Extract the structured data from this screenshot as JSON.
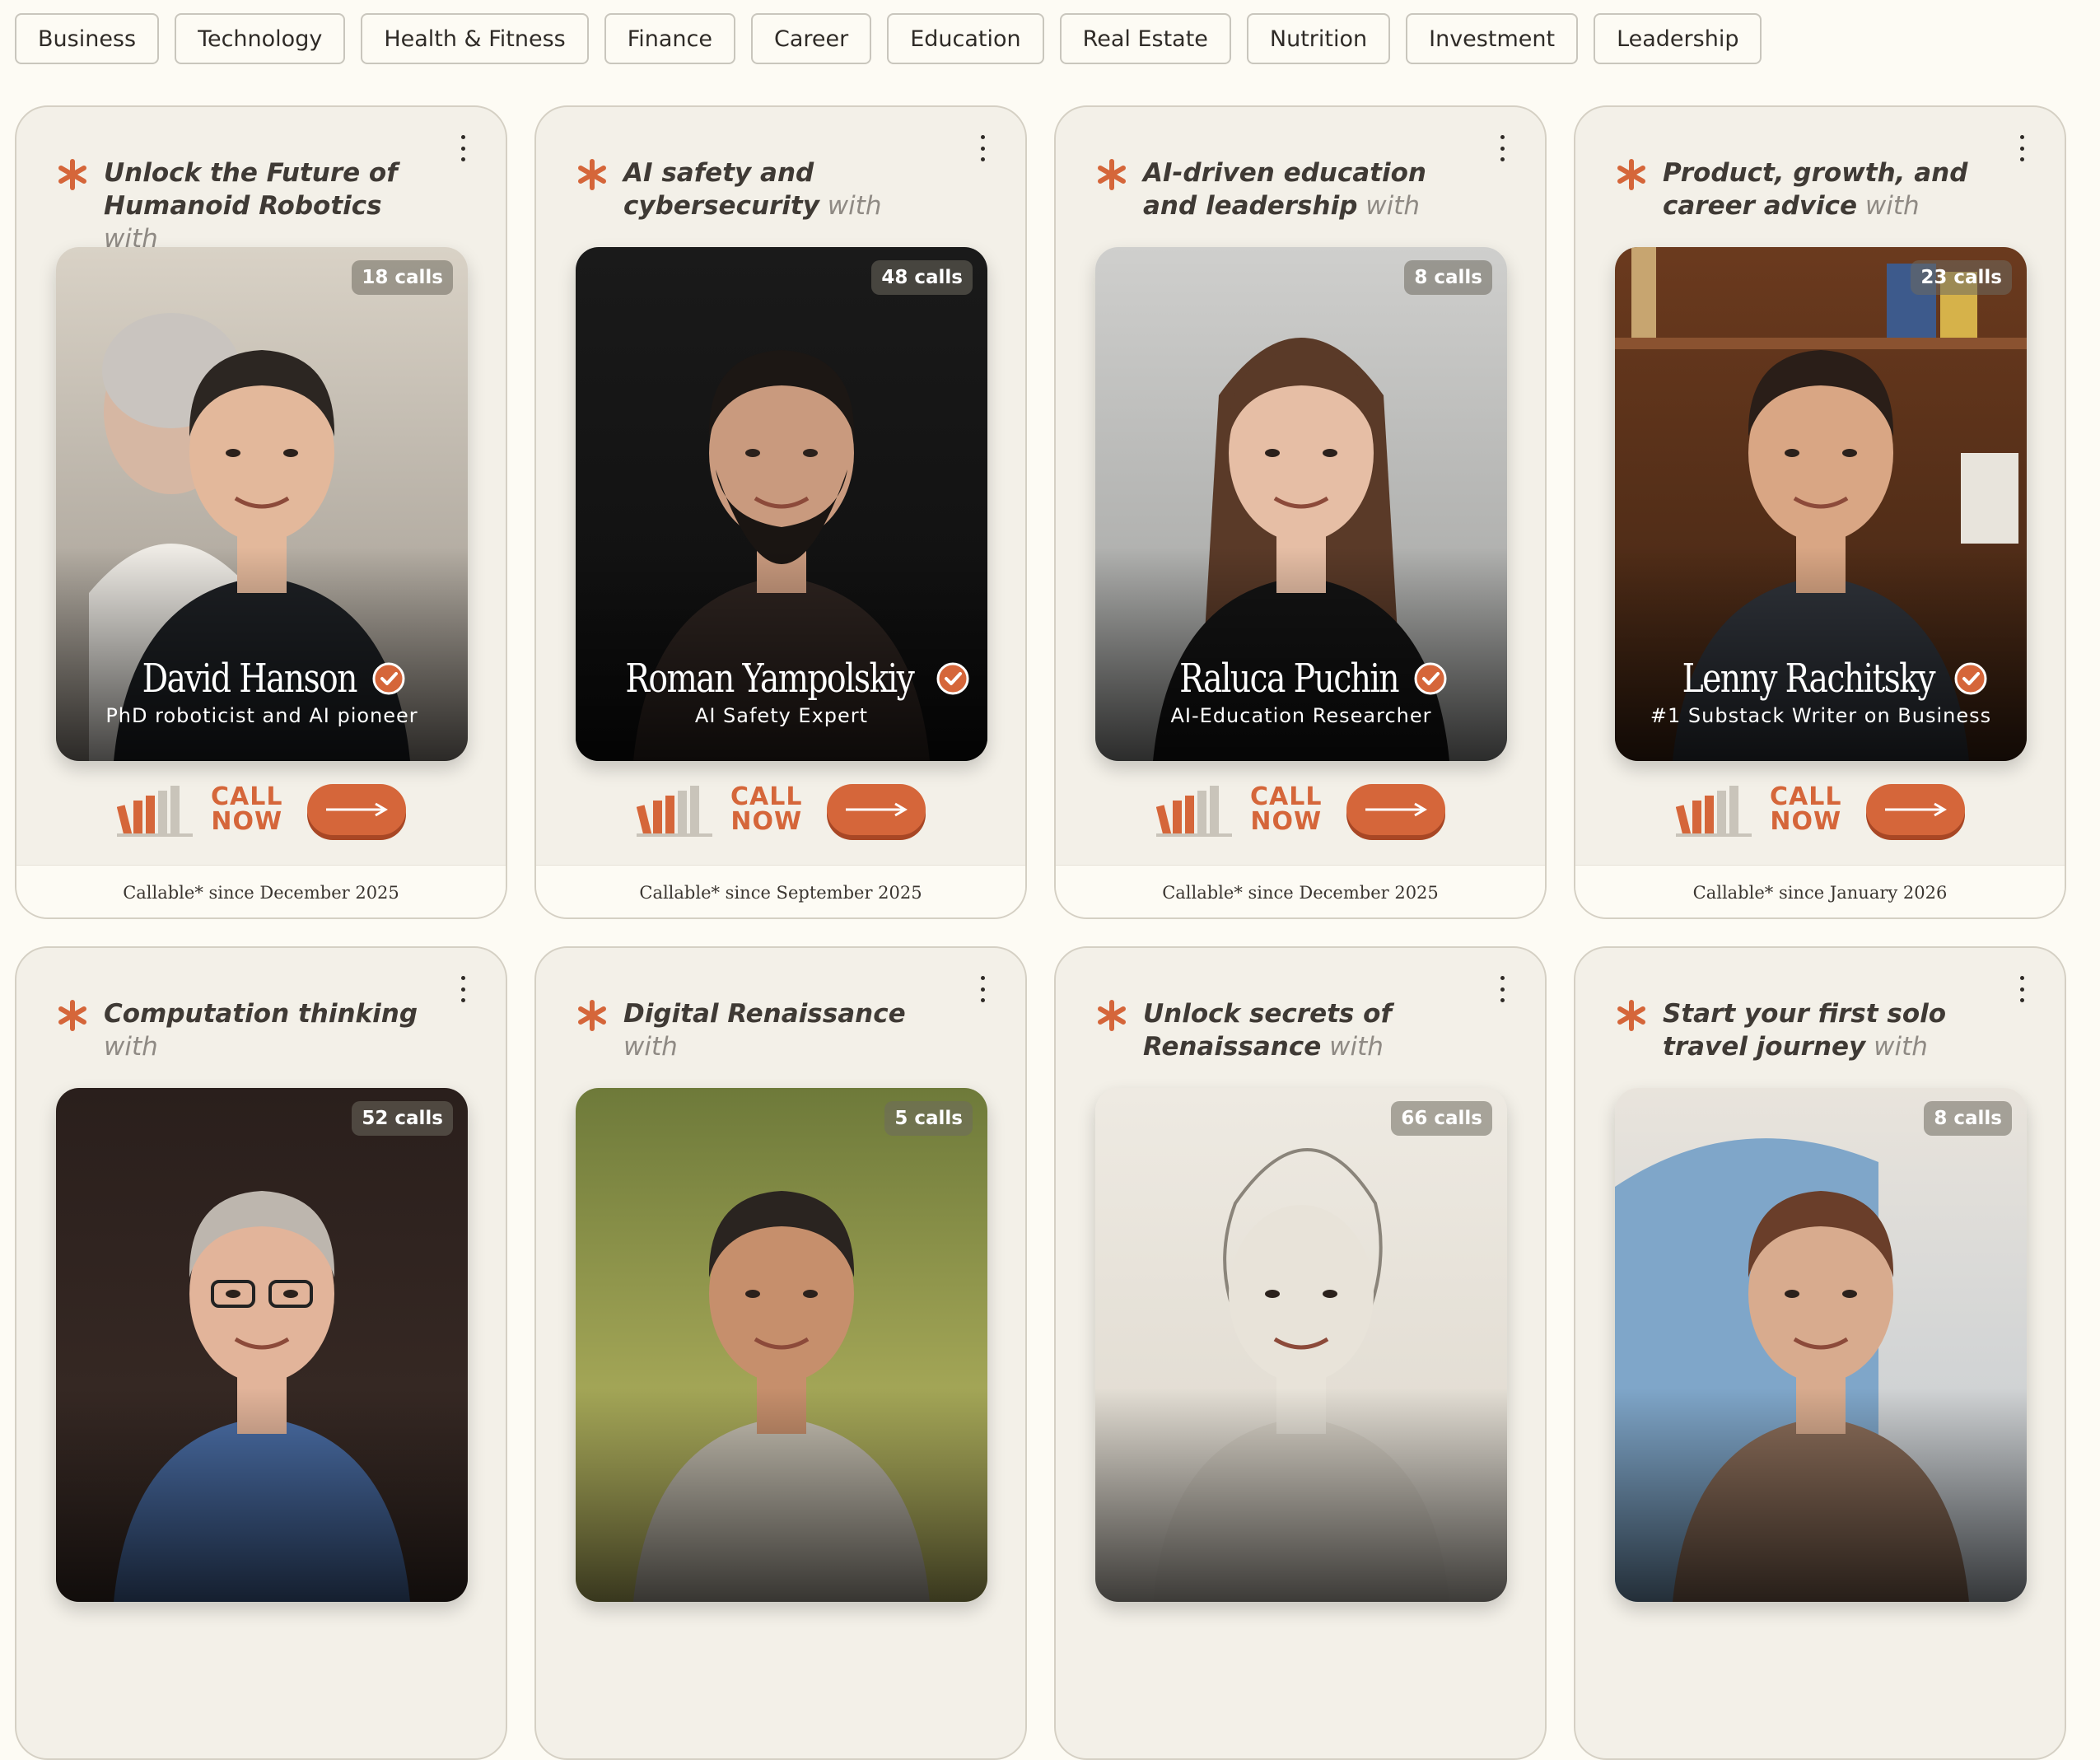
{
  "filters": [
    "Business",
    "Technology",
    "Health & Fitness",
    "Finance",
    "Career",
    "Education",
    "Real Estate",
    "Nutrition",
    "Investment",
    "Leadership"
  ],
  "colors": {
    "accent": "#d5663a",
    "background": "#fdfbf4",
    "card": "#f3f0e8"
  },
  "cta": {
    "call_line1": "CALL",
    "call_line2": "NOW"
  },
  "cards": [
    {
      "title_bold": "Unlock the Future of Humanoid Robotics",
      "title_suffix": " with",
      "calls": "18 calls",
      "name": "David Hanson",
      "role": "PhD roboticist and AI pioneer",
      "footer": "Callable* since December 2025",
      "verified": true
    },
    {
      "title_bold": "AI safety and cybersecurity",
      "title_suffix": " with",
      "calls": "48 calls",
      "name": "Roman Yampolskiy",
      "role": "AI Safety Expert",
      "footer": "Callable* since September 2025",
      "verified": true
    },
    {
      "title_bold": "AI-driven education and leadership",
      "title_suffix": " with",
      "calls": "8 calls",
      "name": "Raluca Puchin",
      "role": "AI-Education Researcher",
      "footer": "Callable* since December 2025",
      "verified": true
    },
    {
      "title_bold": "Product, growth, and career advice",
      "title_suffix": " with",
      "calls": "23 calls",
      "name": "Lenny Rachitsky",
      "role": "#1 Substack Writer on Business",
      "footer": "Callable* since January 2026",
      "verified": true
    },
    {
      "title_bold": "Computation thinking",
      "title_suffix": " with",
      "calls": "52 calls",
      "name": "",
      "role": "",
      "footer": "",
      "verified": false
    },
    {
      "title_bold": "Digital Renaissance",
      "title_suffix": " with",
      "calls": "5 calls",
      "name": "",
      "role": "",
      "footer": "",
      "verified": false
    },
    {
      "title_bold": "Unlock secrets of Renaissance",
      "title_suffix": " with",
      "calls": "66 calls",
      "name": "",
      "role": "",
      "footer": "",
      "verified": false
    },
    {
      "title_bold": "Start your first solo travel journey",
      "title_suffix": " with",
      "calls": "8 calls",
      "name": "",
      "role": "",
      "footer": "",
      "verified": false
    }
  ]
}
